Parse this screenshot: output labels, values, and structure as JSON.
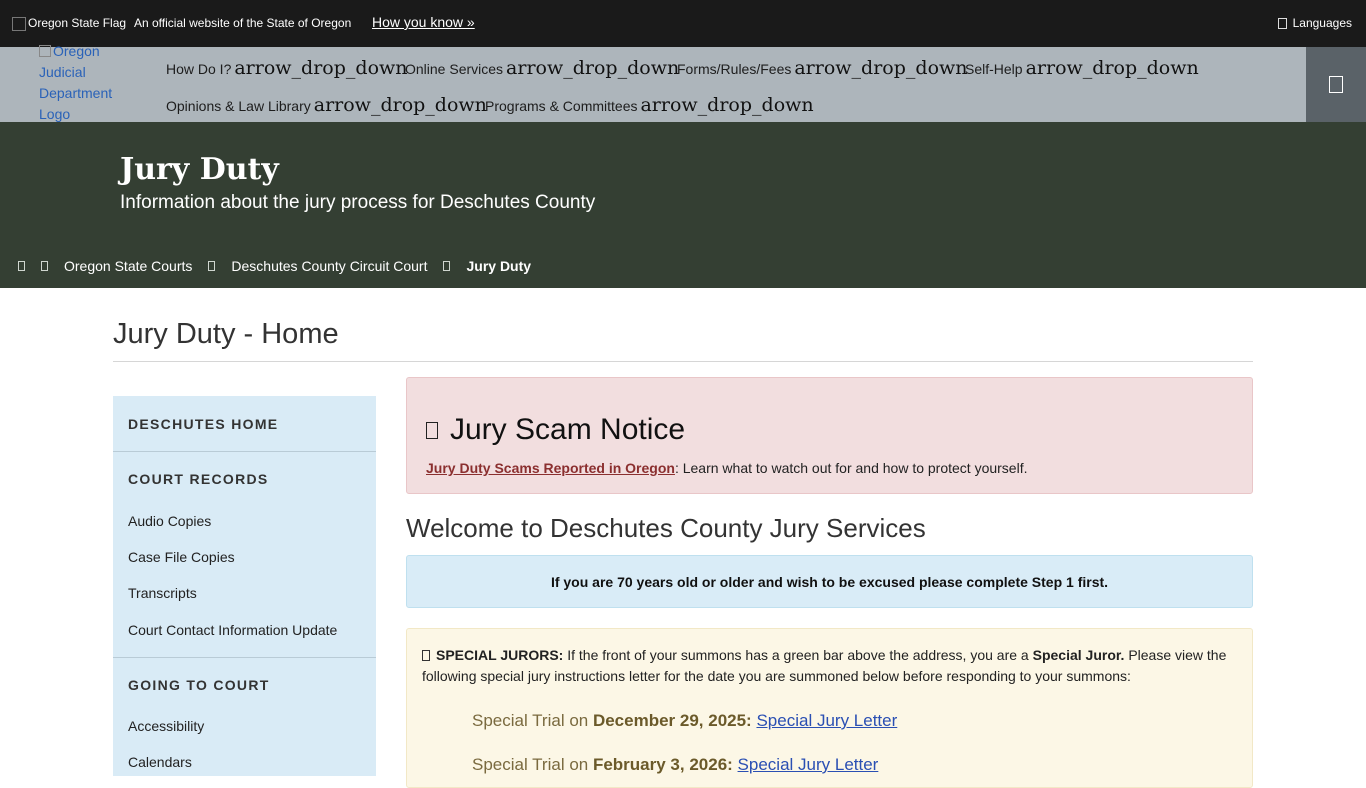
{
  "topbar": {
    "flag_alt": "Oregon State Flag",
    "official_text": "An official website of the State of Oregon",
    "how_you_know": "How you know »",
    "languages": "Languages"
  },
  "nav": {
    "logo_alt": "Oregon Judicial Department Logo",
    "dropdown_icon": "arrow_drop_down",
    "items": [
      {
        "label": "How Do I?"
      },
      {
        "label": "Online Services"
      },
      {
        "label": "Forms/Rules/Fees"
      },
      {
        "label": "Self-Help"
      },
      {
        "label": "Opinions & Law Library"
      },
      {
        "label": "Programs & Committees"
      }
    ]
  },
  "hero": {
    "title": "Jury Duty",
    "subtitle": "Information about the jury process for Deschutes County"
  },
  "breadcrumb": {
    "items": [
      "Oregon State Courts",
      "Deschutes County Circuit Court"
    ],
    "current": "Jury Duty"
  },
  "page": {
    "title": "Jury Duty - Home"
  },
  "sidebar": {
    "sections": [
      {
        "heading": "Deschutes Home",
        "links": []
      },
      {
        "heading": "Court Records",
        "links": [
          "Audio Copies",
          "Case File Copies",
          "Transcripts",
          "Court Contact Information Update"
        ]
      },
      {
        "heading": "Going to Court",
        "links": [
          "Accessibility",
          "Calendars"
        ]
      }
    ]
  },
  "alert": {
    "title": "Jury Scam Notice",
    "link_text": "Jury Duty Scams Reported in Oregon",
    "body": ":  Learn what to watch out for and how to protect yourself."
  },
  "welcome": {
    "heading": "Welcome to Deschutes County Jury Services",
    "notice": "If you are 70 years old or older and wish to be excused please complete Step 1 first."
  },
  "special": {
    "label": "SPECIAL JURORS:",
    "text1": " If the front of your summons has a green bar above the address, you are a ",
    "emph": "Special Juror.",
    "text2": " Please view the following special jury instructions letter for the date you are summoned below before responding to your summons:",
    "trials": [
      {
        "prefix": "Special Trial on ",
        "date": "December 29, 2025:",
        "link": "Special Jury Letter"
      },
      {
        "prefix": "Special Trial on ",
        "date": "February 3, 2026:",
        "link": "Special Jury Letter"
      }
    ]
  },
  "colors": {
    "topbar": "#1a1a1a",
    "nav": "#adb5bb",
    "hero": "#343f33",
    "sidebar": "#d9ebf6",
    "alert": "#f2dedf",
    "info": "#d9ecf7",
    "special": "#fcf7e6"
  }
}
